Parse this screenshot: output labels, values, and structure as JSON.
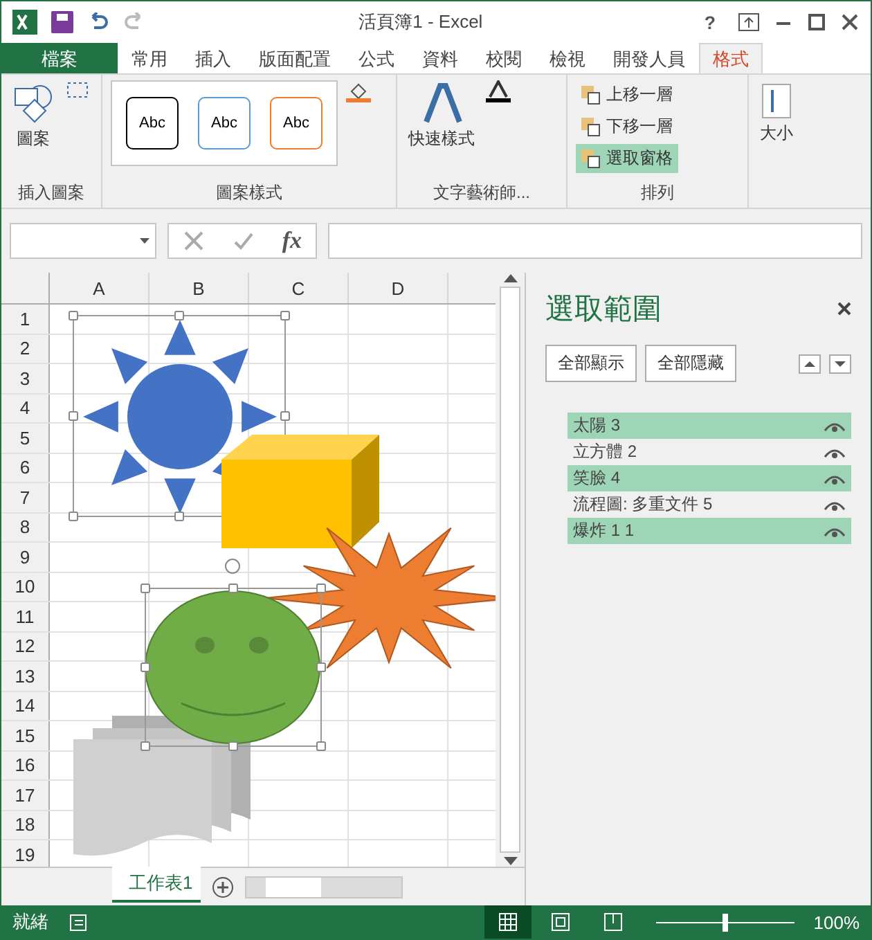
{
  "window": {
    "title": "活頁簿1 - Excel",
    "help": "?"
  },
  "ribbon_tabs": [
    {
      "label": "檔案",
      "kind": "file",
      "selected": false
    },
    {
      "label": "常用",
      "kind": "tab",
      "selected": false
    },
    {
      "label": "插入",
      "kind": "tab",
      "selected": false
    },
    {
      "label": "版面配置",
      "kind": "tab",
      "selected": false
    },
    {
      "label": "公式",
      "kind": "tab",
      "selected": false
    },
    {
      "label": "資料",
      "kind": "tab",
      "selected": false
    },
    {
      "label": "校閱",
      "kind": "tab",
      "selected": false
    },
    {
      "label": "檢視",
      "kind": "tab",
      "selected": false
    },
    {
      "label": "開發人員",
      "kind": "tab",
      "selected": false
    },
    {
      "label": "格式",
      "kind": "tab",
      "selected": true
    }
  ],
  "ribbon": {
    "insert_shapes": {
      "button": "圖案",
      "label": "插入圖案"
    },
    "shape_styles": {
      "label": "圖案樣式",
      "gallery": [
        {
          "text": "Abc",
          "color": "#000000"
        },
        {
          "text": "Abc",
          "color": "#5b9bd5"
        },
        {
          "text": "Abc",
          "color": "#ed7d31"
        }
      ]
    },
    "wordart": {
      "button": "快速樣式",
      "label": "文字藝術師..."
    },
    "arrange": {
      "label": "排列",
      "buttons": [
        {
          "label": "上移一層",
          "active": false
        },
        {
          "label": "下移一層",
          "active": false
        },
        {
          "label": "選取窗格",
          "active": true
        }
      ]
    },
    "size": {
      "button": "大小"
    }
  },
  "formula_bar": {
    "fx": "fx"
  },
  "sheet": {
    "columns": [
      "A",
      "B",
      "C",
      "D"
    ],
    "rows": [
      "1",
      "2",
      "3",
      "4",
      "5",
      "6",
      "7",
      "8",
      "9",
      "10",
      "11",
      "12",
      "13",
      "14",
      "15",
      "16",
      "17",
      "18",
      "19"
    ]
  },
  "selection_pane": {
    "title": "選取範圍",
    "show_all": "全部顯示",
    "hide_all": "全部隱藏",
    "items": [
      {
        "name": "太陽 3",
        "selected": true
      },
      {
        "name": "立方體 2",
        "selected": false
      },
      {
        "name": "笑臉 4",
        "selected": true
      },
      {
        "name": "流程圖: 多重文件 5",
        "selected": false
      },
      {
        "name": "爆炸 1 1",
        "selected": true
      }
    ]
  },
  "sheet_tabs": [
    {
      "label": "工作表1",
      "selected": true
    }
  ],
  "status_bar": {
    "status": "就緒",
    "views": [
      {
        "kind": "normal",
        "selected": true
      },
      {
        "kind": "layout",
        "selected": false
      },
      {
        "kind": "pagebreak",
        "selected": false
      }
    ],
    "zoom": {
      "level": 0.5,
      "reading": "100%"
    }
  }
}
